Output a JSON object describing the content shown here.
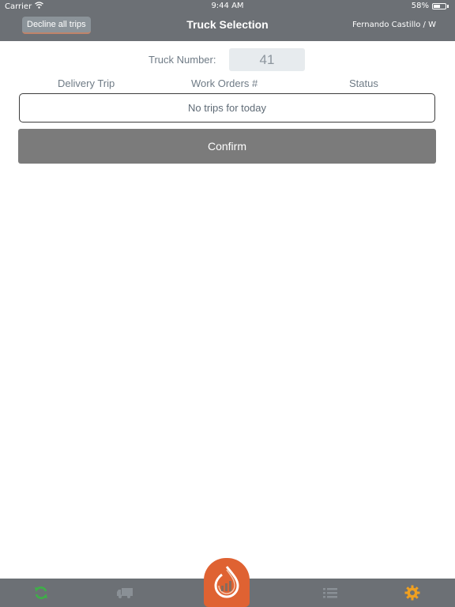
{
  "status_bar": {
    "carrier": "Carrier",
    "time": "9:44 AM",
    "battery": "58%",
    "battery_level": 0.58
  },
  "nav": {
    "decline_label": "Decline all trips",
    "title": "Truck Selection",
    "user": "Fernando Castillo  /  W"
  },
  "truck": {
    "label": "Truck Number:",
    "value": "41"
  },
  "table": {
    "headers": [
      "Delivery Trip",
      "Work Orders #",
      "Status"
    ],
    "empty_message": "No trips for today"
  },
  "confirm_label": "Confirm",
  "tab_bar": {
    "items": [
      {
        "icon": "sync-icon",
        "color": "#3fae49"
      },
      {
        "icon": "truck-icon",
        "color": "#8a9096"
      },
      {
        "icon": "app-logo-icon",
        "color": "#df6232"
      },
      {
        "icon": "list-icon",
        "color": "#8a9096"
      },
      {
        "icon": "gear-icon",
        "color": "#f0a020"
      }
    ]
  },
  "colors": {
    "bar_background": "#6c7075",
    "accent_orange": "#df6232",
    "confirm_button": "#7b7b7b"
  }
}
